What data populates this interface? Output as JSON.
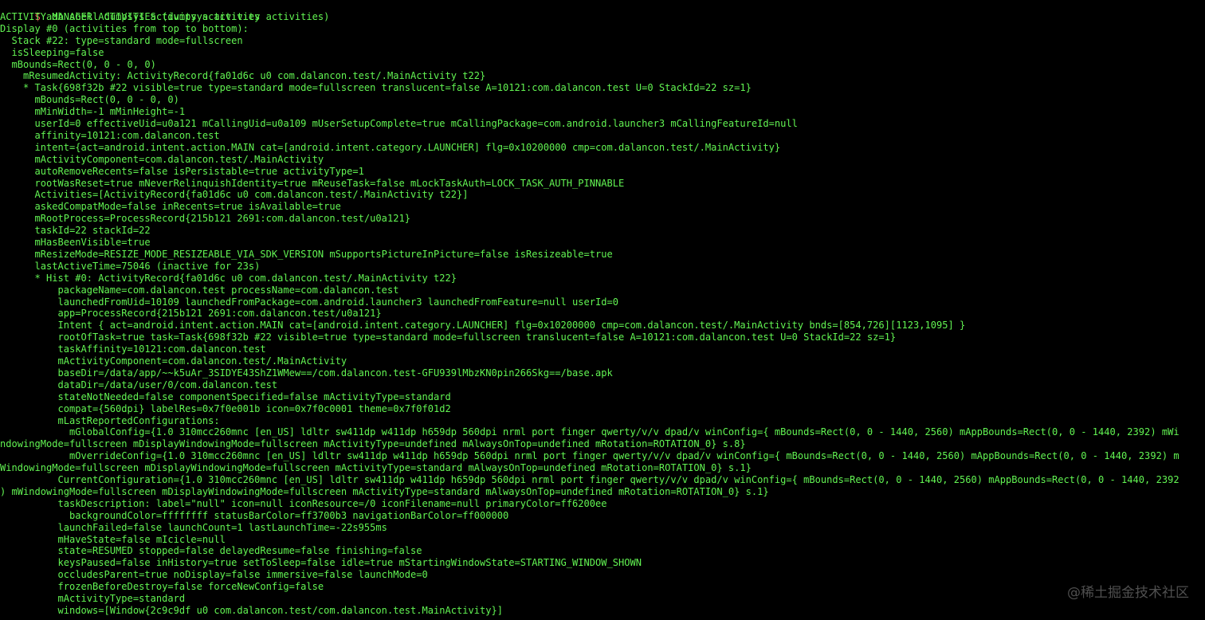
{
  "terminal": {
    "prompt_symbol": "$",
    "command": " adb shell dumpsys activity activities",
    "colors": {
      "text": "#62f452",
      "prompt": "#ff5a5a",
      "background": "#000000"
    },
    "lines": [
      "ACTIVITY MANAGER ACTIVITIES (dumpsys activity activities)",
      "Display #0 (activities from top to bottom):",
      "  Stack #22: type=standard mode=fullscreen",
      "  isSleeping=false",
      "  mBounds=Rect(0, 0 - 0, 0)",
      "    mResumedActivity: ActivityRecord{fa01d6c u0 com.dalancon.test/.MainActivity t22}",
      "    * Task{698f32b #22 visible=true type=standard mode=fullscreen translucent=false A=10121:com.dalancon.test U=0 StackId=22 sz=1}",
      "      mBounds=Rect(0, 0 - 0, 0)",
      "      mMinWidth=-1 mMinHeight=-1",
      "      userId=0 effectiveUid=u0a121 mCallingUid=u0a109 mUserSetupComplete=true mCallingPackage=com.android.launcher3 mCallingFeatureId=null",
      "      affinity=10121:com.dalancon.test",
      "      intent={act=android.intent.action.MAIN cat=[android.intent.category.LAUNCHER] flg=0x10200000 cmp=com.dalancon.test/.MainActivity}",
      "      mActivityComponent=com.dalancon.test/.MainActivity",
      "      autoRemoveRecents=false isPersistable=true activityType=1",
      "      rootWasReset=true mNeverRelinquishIdentity=true mReuseTask=false mLockTaskAuth=LOCK_TASK_AUTH_PINNABLE",
      "      Activities=[ActivityRecord{fa01d6c u0 com.dalancon.test/.MainActivity t22}]",
      "      askedCompatMode=false inRecents=true isAvailable=true",
      "      mRootProcess=ProcessRecord{215b121 2691:com.dalancon.test/u0a121}",
      "      taskId=22 stackId=22",
      "      mHasBeenVisible=true",
      "      mResizeMode=RESIZE_MODE_RESIZEABLE_VIA_SDK_VERSION mSupportsPictureInPicture=false isResizeable=true",
      "      lastActiveTime=75046 (inactive for 23s)",
      "      * Hist #0: ActivityRecord{fa01d6c u0 com.dalancon.test/.MainActivity t22}",
      "          packageName=com.dalancon.test processName=com.dalancon.test",
      "          launchedFromUid=10109 launchedFromPackage=com.android.launcher3 launchedFromFeature=null userId=0",
      "          app=ProcessRecord{215b121 2691:com.dalancon.test/u0a121}",
      "          Intent { act=android.intent.action.MAIN cat=[android.intent.category.LAUNCHER] flg=0x10200000 cmp=com.dalancon.test/.MainActivity bnds=[854,726][1123,1095] }",
      "          rootOfTask=true task=Task{698f32b #22 visible=true type=standard mode=fullscreen translucent=false A=10121:com.dalancon.test U=0 StackId=22 sz=1}",
      "          taskAffinity=10121:com.dalancon.test",
      "          mActivityComponent=com.dalancon.test/.MainActivity",
      "          baseDir=/data/app/~~k5uAr_3SIDYE43ShZ1WMew==/com.dalancon.test-GFU939lMbzKN0pin266Skg==/base.apk",
      "          dataDir=/data/user/0/com.dalancon.test",
      "          stateNotNeeded=false componentSpecified=false mActivityType=standard",
      "          compat={560dpi} labelRes=0x7f0e001b icon=0x7f0c0001 theme=0x7f0f01d2",
      "          mLastReportedConfigurations:",
      "            mGlobalConfig={1.0 310mcc260mnc [en_US] ldltr sw411dp w411dp h659dp 560dpi nrml port finger qwerty/v/v dpad/v winConfig={ mBounds=Rect(0, 0 - 1440, 2560) mAppBounds=Rect(0, 0 - 1440, 2392) mWi",
      "ndowingMode=fullscreen mDisplayWindowingMode=fullscreen mActivityType=undefined mAlwaysOnTop=undefined mRotation=ROTATION_0} s.8}",
      "            mOverrideConfig={1.0 310mcc260mnc [en_US] ldltr sw411dp w411dp h659dp 560dpi nrml port finger qwerty/v/v dpad/v winConfig={ mBounds=Rect(0, 0 - 1440, 2560) mAppBounds=Rect(0, 0 - 1440, 2392) m",
      "WindowingMode=fullscreen mDisplayWindowingMode=fullscreen mActivityType=standard mAlwaysOnTop=undefined mRotation=ROTATION_0} s.1}",
      "          CurrentConfiguration={1.0 310mcc260mnc [en_US] ldltr sw411dp w411dp h659dp 560dpi nrml port finger qwerty/v/v dpad/v winConfig={ mBounds=Rect(0, 0 - 1440, 2560) mAppBounds=Rect(0, 0 - 1440, 2392",
      ") mWindowingMode=fullscreen mDisplayWindowingMode=fullscreen mActivityType=standard mAlwaysOnTop=undefined mRotation=ROTATION_0} s.1}",
      "          taskDescription: label=\"null\" icon=null iconResource=/0 iconFilename=null primaryColor=ff6200ee",
      "            backgroundColor=ffffffff statusBarColor=ff3700b3 navigationBarColor=ff000000",
      "          launchFailed=false launchCount=1 lastLaunchTime=-22s955ms",
      "          mHaveState=false mIcicle=null",
      "          state=RESUMED stopped=false delayedResume=false finishing=false",
      "          keysPaused=false inHistory=true setToSleep=false idle=true mStartingWindowState=STARTING_WINDOW_SHOWN",
      "          occludesParent=true noDisplay=false immersive=false launchMode=0",
      "          frozenBeforeDestroy=false forceNewConfig=false",
      "          mActivityType=standard",
      "          windows=[Window{2c9c9df u0 com.dalancon.test/com.dalancon.test.MainActivity}]"
    ]
  },
  "watermark": {
    "text": "@稀土掘金技术社区"
  }
}
